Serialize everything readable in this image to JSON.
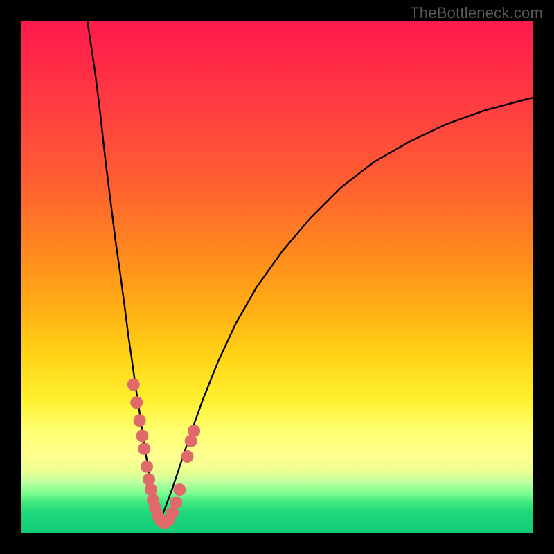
{
  "watermark_text": "TheBottleneck.com",
  "colors": {
    "frame": "#000000",
    "curve_stroke": "#000000",
    "marker_fill": "#e06a6a",
    "marker_stroke": "#d85e5e",
    "watermark": "#595959"
  },
  "chart_data": {
    "type": "line",
    "title": "",
    "xlabel": "",
    "ylabel": "",
    "xlim": [
      0,
      100
    ],
    "ylim": [
      0,
      100
    ],
    "note": "No numeric axis labels shown; values are estimated positions (% of plot width/height, origin at bottom-left) of the two curve branches and the highlighted markers.",
    "series": [
      {
        "name": "left-branch",
        "x": [
          13.0,
          14.5,
          15.5,
          16.5,
          17.5,
          18.5,
          19.5,
          20.3,
          21.0,
          21.8,
          22.5,
          23.2,
          23.8,
          24.3,
          24.8,
          25.2,
          25.6,
          25.9,
          26.2,
          26.5,
          27.0
        ],
        "y": [
          100.0,
          90.0,
          82.0,
          73.0,
          65.0,
          57.0,
          50.0,
          44.0,
          38.5,
          33.0,
          28.0,
          23.5,
          19.5,
          16.0,
          13.0,
          10.5,
          8.5,
          6.8,
          5.3,
          4.0,
          2.0
        ]
      },
      {
        "name": "right-branch",
        "x": [
          27.0,
          28.0,
          29.5,
          31.0,
          33.0,
          35.5,
          38.5,
          42.0,
          46.0,
          51.0,
          56.5,
          62.5,
          69.0,
          76.0,
          83.0,
          90.5,
          98.0,
          100.0
        ],
        "y": [
          2.0,
          4.5,
          8.5,
          13.0,
          19.0,
          26.0,
          33.5,
          41.0,
          48.0,
          55.0,
          61.5,
          67.5,
          72.5,
          76.5,
          79.8,
          82.5,
          84.5,
          85.0
        ]
      }
    ],
    "markers": [
      {
        "x": 22.0,
        "y": 29.0
      },
      {
        "x": 22.6,
        "y": 25.5
      },
      {
        "x": 23.2,
        "y": 22.0
      },
      {
        "x": 23.7,
        "y": 19.0
      },
      {
        "x": 24.1,
        "y": 16.5
      },
      {
        "x": 24.6,
        "y": 13.0
      },
      {
        "x": 25.0,
        "y": 10.5
      },
      {
        "x": 25.4,
        "y": 8.5
      },
      {
        "x": 25.8,
        "y": 6.5
      },
      {
        "x": 26.2,
        "y": 5.0
      },
      {
        "x": 26.7,
        "y": 3.5
      },
      {
        "x": 27.3,
        "y": 2.5
      },
      {
        "x": 28.0,
        "y": 2.0
      },
      {
        "x": 28.8,
        "y": 2.5
      },
      {
        "x": 29.6,
        "y": 4.0
      },
      {
        "x": 30.3,
        "y": 6.0
      },
      {
        "x": 31.0,
        "y": 8.5
      },
      {
        "x": 32.5,
        "y": 15.0
      },
      {
        "x": 33.2,
        "y": 18.0
      },
      {
        "x": 33.8,
        "y": 20.0
      }
    ],
    "marker_radius_px": 9
  }
}
